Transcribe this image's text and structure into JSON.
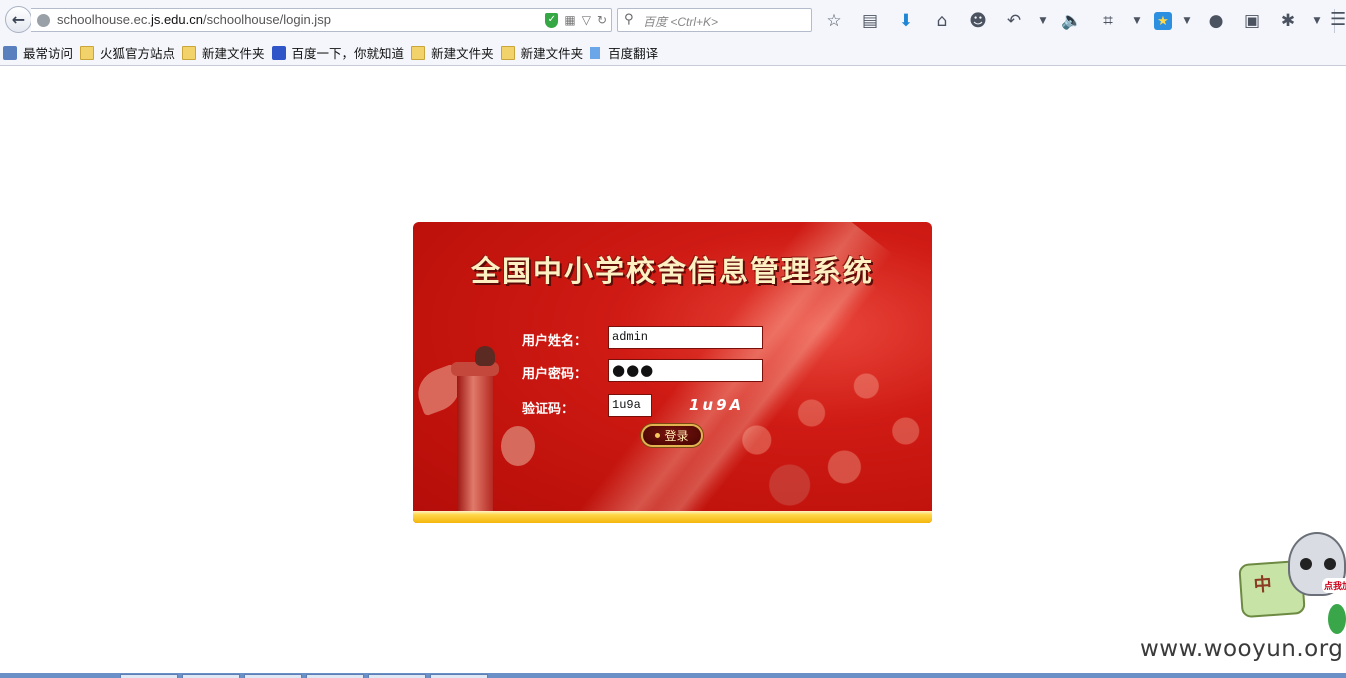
{
  "browser": {
    "url_prefix": "schoolhouse.ec.",
    "url_domain": "js.edu.cn",
    "url_path": "/schoolhouse/login.jsp",
    "search_placeholder": "百度 <Ctrl+K>",
    "icons": [
      "back-icon",
      "globe-icon",
      "shield-icon",
      "qrcode-icon",
      "dropdown-icon",
      "reload-icon",
      "search-icon",
      "bookmark-star-icon",
      "reading-list-icon",
      "download-icon",
      "home-icon",
      "chat-icon",
      "undo-icon",
      "speaker-icon",
      "crop-icon",
      "favorite-star-icon",
      "message-icon",
      "translate-icon",
      "bee-icon",
      "menu-icon"
    ]
  },
  "bookmarks": [
    {
      "label": "最常访问",
      "icon": "most-visited-icon"
    },
    {
      "label": "火狐官方站点",
      "icon": "folder-icon"
    },
    {
      "label": "新建文件夹",
      "icon": "folder-icon"
    },
    {
      "label": "百度一下，你就知道",
      "icon": "baidu-paw-icon"
    },
    {
      "label": "新建文件夹",
      "icon": "folder-icon"
    },
    {
      "label": "新建文件夹",
      "icon": "folder-icon"
    },
    {
      "label": "百度翻译",
      "icon": "baidu-translate-icon"
    }
  ],
  "login": {
    "title": "全国中小学校舍信息管理系统",
    "username_label": "用户姓名：",
    "username_value": "admin",
    "password_label": "用户密码：",
    "password_mask": "●●●",
    "captcha_label": "验证码：",
    "captcha_value": "1u9a",
    "captcha_image_text": "1u9A",
    "login_button": "登录"
  },
  "overlay": {
    "mascot_sign": "中",
    "mascot_tag": "点我加",
    "watermark": "www.wooyun.org"
  },
  "colors": {
    "panel_red": "#c1120c",
    "title_cream": "#fdf1c4",
    "gold": "#f4b60c"
  }
}
